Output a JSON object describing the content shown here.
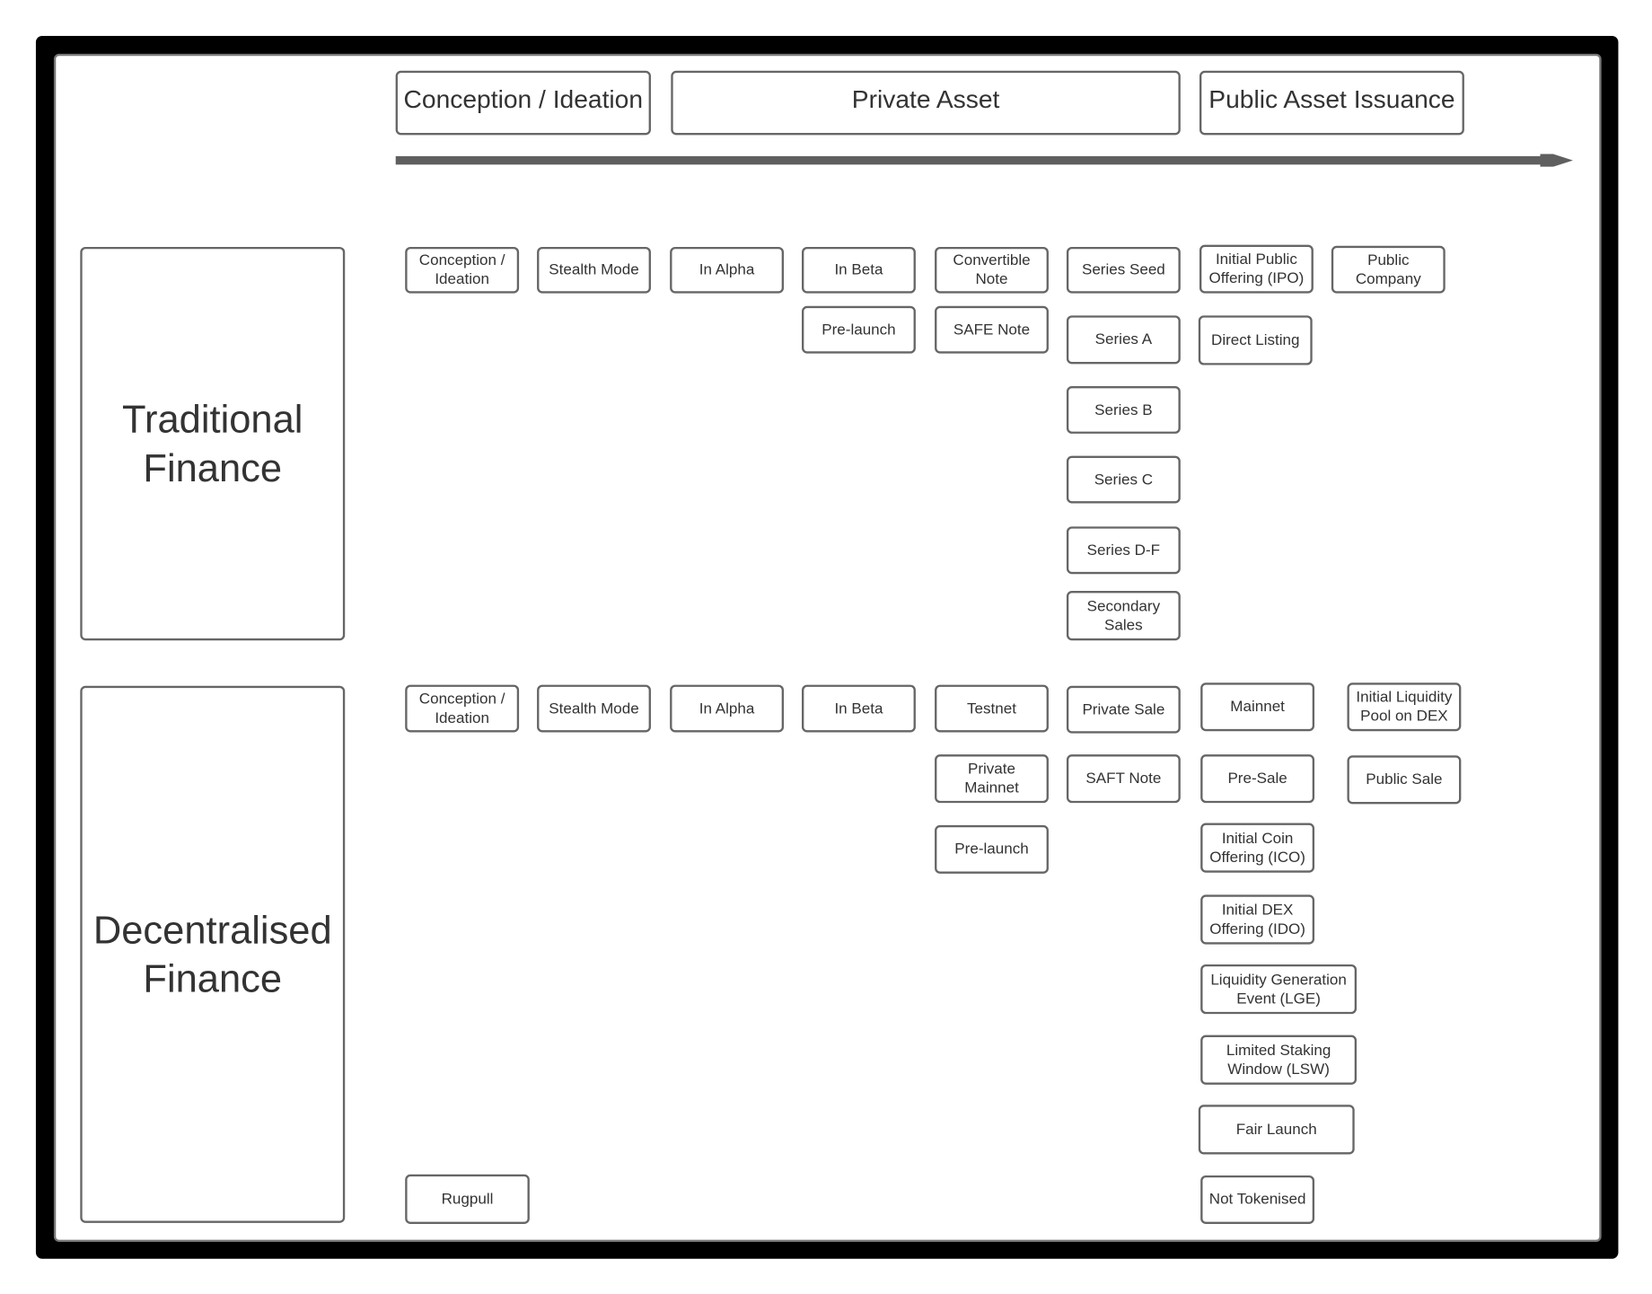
{
  "phases": [
    "Conception / Ideation",
    "Private Asset",
    "Public Asset Issuance"
  ],
  "lanes": {
    "traditional": "Traditional\nFinance",
    "decentralised": "Decentralised\nFinance"
  },
  "traditional": {
    "conception": "Conception /\nIdeation",
    "stealth": "Stealth Mode",
    "alpha": "In Alpha",
    "beta": "In Beta",
    "convertible": "Convertible\nNote",
    "seed": "Series Seed",
    "ipo": "Initial Public\nOffering (IPO)",
    "public_company": "Public\nCompany",
    "prelaunch": "Pre-launch",
    "safe": "SAFE Note",
    "series_a": "Series A",
    "direct_listing": "Direct Listing",
    "series_b": "Series B",
    "series_c": "Series C",
    "series_df": "Series D-F",
    "secondary": "Secondary\nSales"
  },
  "decentralised": {
    "conception": "Conception /\nIdeation",
    "stealth": "Stealth Mode",
    "alpha": "In Alpha",
    "beta": "In Beta",
    "testnet": "Testnet",
    "private_sale": "Private Sale",
    "mainnet": "Mainnet",
    "ilp": "Initial Liquidity\nPool on DEX",
    "private_mainnet": "Private\nMainnet",
    "saft": "SAFT Note",
    "presale": "Pre-Sale",
    "public_sale": "Public Sale",
    "prelaunch": "Pre-launch",
    "ico": "Initial Coin\nOffering (ICO)",
    "ido": "Initial DEX\nOffering (IDO)",
    "lge": "Liquidity Generation\nEvent (LGE)",
    "lsw": "Limited Staking\nWindow (LSW)",
    "fair_launch": "Fair Launch",
    "not_tokenised": "Not Tokenised",
    "rugpull": "Rugpull"
  },
  "colors": {
    "frame": "#000000",
    "stroke": "#666666",
    "arrow": "#5f5f5f",
    "text": "#333333"
  }
}
